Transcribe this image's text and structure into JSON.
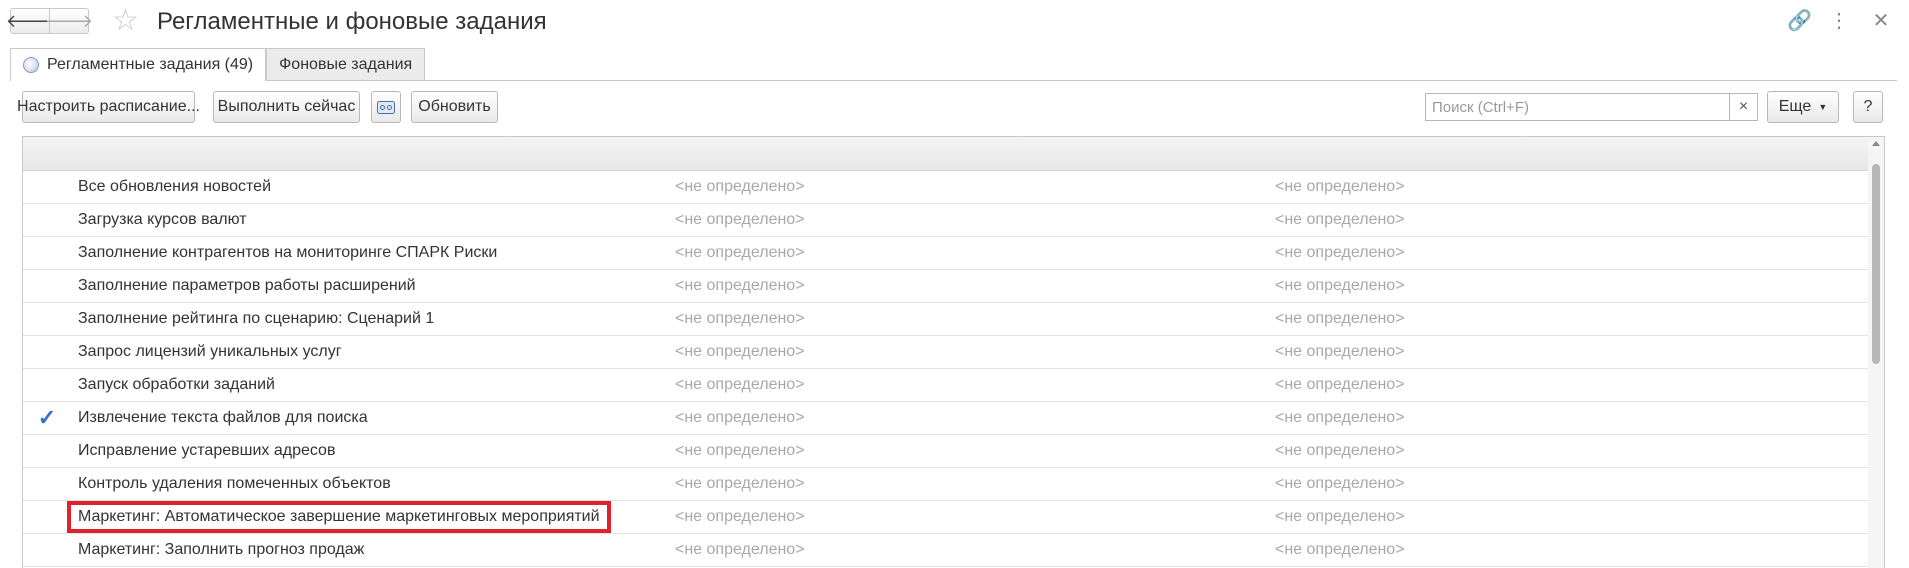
{
  "window": {
    "title": "Регламентные и фоновые задания",
    "nav_back_icon": "arrow-left-icon",
    "nav_forward_icon": "arrow-right-icon",
    "favorite_icon": "star-icon",
    "top_icons": [
      "link-icon",
      "more-vertical-icon",
      "close-icon"
    ]
  },
  "tabs": [
    {
      "label": "Регламентные задания (49)",
      "active": true,
      "icon": "scheduled-tasks-icon"
    },
    {
      "label": "Фоновые задания",
      "active": false
    }
  ],
  "toolbar": {
    "configure_label": "Настроить расписание...",
    "run_now_label": "Выполнить сейчас",
    "cassette_icon": "cassette-icon",
    "refresh_label": "Обновить",
    "search_placeholder": "Поиск (Ctrl+F)",
    "search_clear_label": "×",
    "more_label": "Еще",
    "help_label": "?"
  },
  "rows": [
    {
      "name": "Все обновления новостей",
      "c2": "<не определено>",
      "c3": "<не определено>",
      "checked": false
    },
    {
      "name": "Загрузка курсов валют",
      "c2": "<не определено>",
      "c3": "<не определено>",
      "checked": false
    },
    {
      "name": "Заполнение контрагентов на мониторинге СПАРК Риски",
      "c2": "<не определено>",
      "c3": "<не определено>",
      "checked": false
    },
    {
      "name": "Заполнение параметров работы расширений",
      "c2": "<не определено>",
      "c3": "<не определено>",
      "checked": false
    },
    {
      "name": "Заполнение рейтинга по сценарию: Сценарий 1",
      "c2": "<не определено>",
      "c3": "<не определено>",
      "checked": false
    },
    {
      "name": "Запрос лицензий уникальных услуг",
      "c2": "<не определено>",
      "c3": "<не определено>",
      "checked": false
    },
    {
      "name": "Запуск обработки заданий",
      "c2": "<не определено>",
      "c3": "<не определено>",
      "checked": false
    },
    {
      "name": "Извлечение текста файлов для поиска",
      "c2": "<не определено>",
      "c3": "<не определено>",
      "checked": true,
      "check_glyph": "✓"
    },
    {
      "name": "Исправление устаревших адресов",
      "c2": "<не определено>",
      "c3": "<не определено>",
      "checked": false
    },
    {
      "name": "Контроль удаления помеченных объектов",
      "c2": "<не определено>",
      "c3": "<не определено>",
      "checked": false
    },
    {
      "name": "Маркетинг: Автоматическое завершение маркетинговых мероприятий",
      "c2": "<не определено>",
      "c3": "<не определено>",
      "checked": false,
      "highlight": true
    },
    {
      "name": "Маркетинг: Заполнить прогноз продаж",
      "c2": "<не определено>",
      "c3": "<не определено>",
      "checked": false
    }
  ],
  "colors": {
    "highlight_border": "#e0232b",
    "check": "#2e74c9",
    "muted_text": "#a8a8a8"
  }
}
